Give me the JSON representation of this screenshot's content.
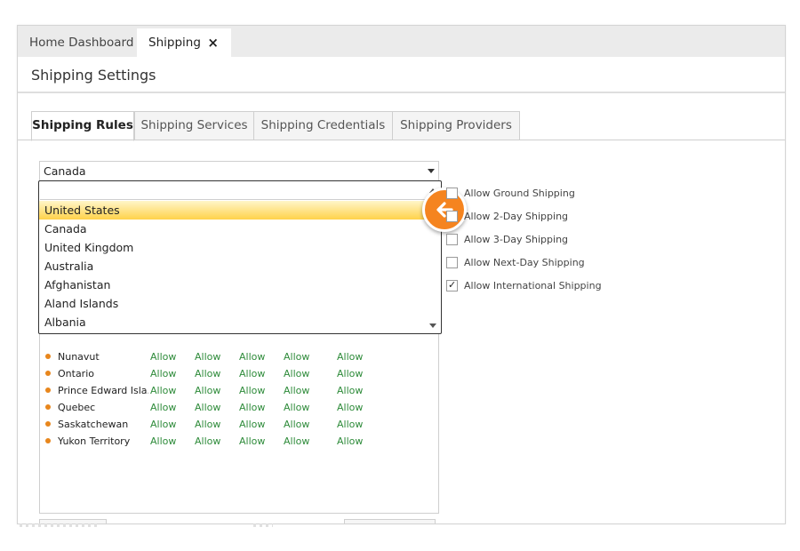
{
  "doc_tabs": [
    {
      "label": "Home Dashboard"
    },
    {
      "label": "Shipping",
      "close": "×"
    }
  ],
  "page_title": "Shipping Settings",
  "sub_tabs": [
    {
      "label": "Shipping Rules"
    },
    {
      "label": "Shipping Services"
    },
    {
      "label": "Shipping Credentials"
    },
    {
      "label": "Shipping Providers"
    }
  ],
  "country_select": {
    "value": "Canada",
    "icon": "chevron-down-icon"
  },
  "dropdown": {
    "options": [
      "United States",
      "Canada",
      "United Kingdom",
      "Australia",
      "Afghanistan",
      "Aland Islands",
      "Albania"
    ],
    "highlighted": "United States"
  },
  "provinces": [
    {
      "name": "Nunavut",
      "cells": [
        "Allow",
        "Allow",
        "Allow",
        "Allow",
        "Allow"
      ]
    },
    {
      "name": "Ontario",
      "cells": [
        "Allow",
        "Allow",
        "Allow",
        "Allow",
        "Allow"
      ]
    },
    {
      "name": "Prince Edward Isla...",
      "cells": [
        "Allow",
        "Allow",
        "Allow",
        "Allow",
        "Allow"
      ]
    },
    {
      "name": "Quebec",
      "cells": [
        "Allow",
        "Allow",
        "Allow",
        "Allow",
        "Allow"
      ]
    },
    {
      "name": "Saskatchewan",
      "cells": [
        "Allow",
        "Allow",
        "Allow",
        "Allow",
        "Allow"
      ]
    },
    {
      "name": "Yukon Territory",
      "cells": [
        "Allow",
        "Allow",
        "Allow",
        "Allow",
        "Allow"
      ]
    }
  ],
  "shipping_options": [
    {
      "label": "Allow Ground Shipping",
      "checked": false
    },
    {
      "label": "Allow 2-Day Shipping",
      "checked": false
    },
    {
      "label": "Allow 3-Day Shipping",
      "checked": false
    },
    {
      "label": "Allow Next-Day Shipping",
      "checked": false
    },
    {
      "label": "Allow International Shipping",
      "checked": true
    }
  ],
  "colors": {
    "accent": "#f5841f",
    "allow_text": "#2e8b3a",
    "highlight": "#ffd24a"
  },
  "icons": {
    "pointer": "arrow-left-icon",
    "close": "close-icon"
  }
}
